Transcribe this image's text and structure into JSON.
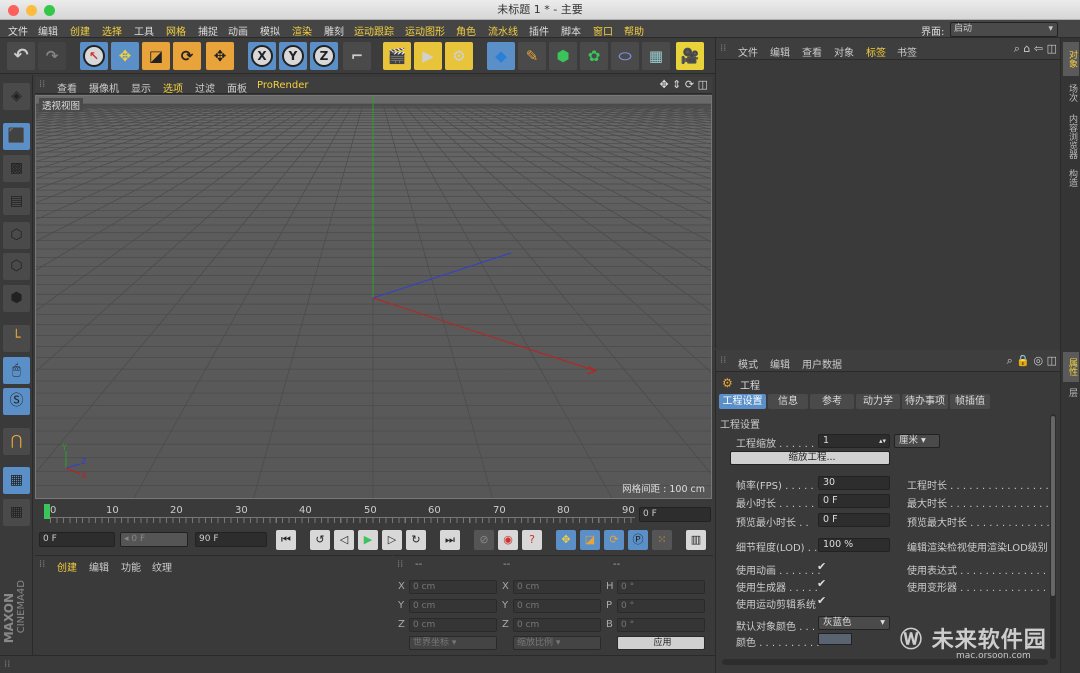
{
  "window": {
    "title": "未标题 1 * - 主要"
  },
  "menu": {
    "items": [
      "文件",
      "编辑",
      "创建",
      "选择",
      "工具",
      "网格",
      "捕捉",
      "动画",
      "模拟",
      "渲染",
      "雕刻",
      "运动跟踪",
      "运动图形",
      "角色",
      "流水线",
      "插件",
      "脚本",
      "窗口",
      "帮助"
    ],
    "layout_label": "界面:",
    "layout_value": "启动"
  },
  "toolbar": {
    "undo": "↶",
    "axis_x": "X",
    "axis_y": "Y",
    "axis_z": "Z"
  },
  "viewport": {
    "menu": [
      "查看",
      "摄像机",
      "显示",
      "选项",
      "过滤",
      "面板",
      "ProRender"
    ],
    "label": "透视视图",
    "grid_info": "网格间距 : 100 cm"
  },
  "timeline": {
    "ticks": [
      "0",
      "10",
      "20",
      "30",
      "40",
      "50",
      "60",
      "70",
      "80",
      "90"
    ],
    "frame": "0 F"
  },
  "controls": {
    "start": "0 F",
    "current": "0 F",
    "end": "90 F"
  },
  "material": {
    "menu": [
      "创建",
      "编辑",
      "功能",
      "纹理"
    ]
  },
  "coords": {
    "header": [
      "--",
      "--",
      "--"
    ],
    "rows": [
      {
        "a": "X",
        "av": "0 cm",
        "b": "X",
        "bv": "0 cm",
        "c": "H",
        "cv": "0 °"
      },
      {
        "a": "Y",
        "av": "0 cm",
        "b": "Y",
        "bv": "0 cm",
        "c": "P",
        "cv": "0 °"
      },
      {
        "a": "Z",
        "av": "0 cm",
        "b": "Z",
        "bv": "0 cm",
        "c": "B",
        "cv": "0 °"
      }
    ],
    "world": "世界坐标",
    "scale": "缩放比例",
    "apply": "应用"
  },
  "objects": {
    "menu": [
      "文件",
      "编辑",
      "查看",
      "对象",
      "标签",
      "书签"
    ]
  },
  "attributes": {
    "menu": [
      "模式",
      "编辑",
      "用户数据"
    ],
    "title": "工程",
    "tabs": [
      "工程设置",
      "信息",
      "参考",
      "动力学",
      "待办事项",
      "帧插值"
    ],
    "section": "工程设置",
    "scale_label": "工程缩放 . . . . . . .",
    "scale_value": "1",
    "scale_unit": "厘米",
    "scale_button": "缩放工程...",
    "fps_label": "帧率(FPS) . . . . . .",
    "fps_value": "30",
    "duration_label": "工程时长 . . . . . . . . . . . . . . . . .",
    "min_label": "最小时长 . . . . . .",
    "min_value": "0 F",
    "max_label": "最大时长 . . . . . . . . . . . . . . . . .",
    "pmin_label": "预览最小时长 . .",
    "pmin_value": "0 F",
    "pmax_label": "预览最大时长 . . . . . . . . . . . . .",
    "lod_label": "细节程度(LOD) . .",
    "lod_value": "100 %",
    "lod_right": "编辑渲染检视使用渲染LOD级别",
    "anim_label": "使用动画 . . . . . . .",
    "expr_label": "使用表达式 . . . . . . . . . . . . . . .",
    "gen_label": "使用生成器 . . . . .",
    "deform_label": "使用变形器 . . . . . . . . . . . . . . .",
    "motion_label": "使用运动剪辑系统",
    "color_label": "默认对象颜色 . . .",
    "color_value": "灰蓝色",
    "color2_label": "颜色 . . . . . . . . . .",
    "swatch": "#5a6470"
  },
  "sidetabs": {
    "top": [
      "对象",
      "场次",
      "内容浏览器",
      "构造"
    ],
    "bottom": [
      "属性",
      "层"
    ]
  },
  "brand": {
    "maxon": "MAXON",
    "cinema": "CINEMA4D",
    "watermark": "未来软件园",
    "watermark_url": "mac.orsoon.com"
  }
}
